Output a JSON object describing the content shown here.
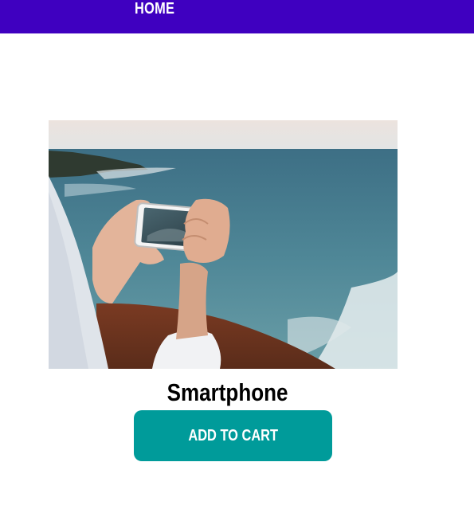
{
  "nav": {
    "home_label": "HOME"
  },
  "product": {
    "image_alt": "Hands holding a smartphone photographing the ocean coastline",
    "name": "Smartphone",
    "add_to_cart_label": "ADD TO CART"
  },
  "colors": {
    "nav_bar": "#3f00c0",
    "button": "#009b9a"
  }
}
